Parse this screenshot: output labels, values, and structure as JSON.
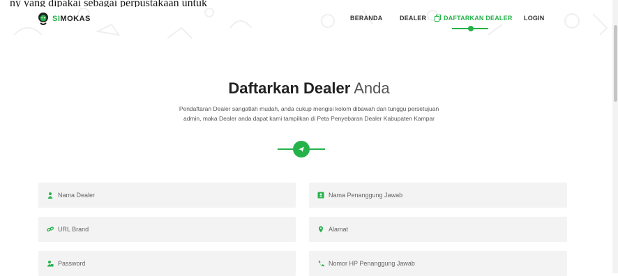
{
  "top_partial_text": "ny yang dipakai sebagai perpustakaan untuk",
  "brand": {
    "prefix": "SI",
    "rest": "MOKAS"
  },
  "nav": {
    "items": [
      {
        "label": "BERANDA"
      },
      {
        "label": "DEALER"
      },
      {
        "label": "DAFTARKAN DEALER"
      },
      {
        "label": "LOGIN"
      }
    ],
    "active_index": 2
  },
  "hero": {
    "title_bold": "Daftarkan Dealer",
    "title_light": "Anda",
    "description": "Pendaftaran Dealer sangatlah mudah, anda cukup mengisi kolom dibawah dan tunggu persetujuan admin, maka Dealer anda dapat kami tampilkan di Peta Penyebaran Dealer Kabupaten Kampar"
  },
  "form": {
    "fields": [
      {
        "placeholder": "Nama Dealer",
        "icon": "user-icon"
      },
      {
        "placeholder": "Nama Penanggung Jawab",
        "icon": "contact-card-icon"
      },
      {
        "placeholder": "URL Brand",
        "icon": "link-icon"
      },
      {
        "placeholder": "Alamat",
        "icon": "map-marker-icon"
      },
      {
        "placeholder": "Password",
        "icon": "user-lock-icon"
      },
      {
        "placeholder": "Nomor HP Penanggung Jawab",
        "icon": "phone-icon"
      }
    ]
  },
  "colors": {
    "accent": "#25b24a",
    "field_bg": "#f3f3f3",
    "text": "#333333"
  }
}
